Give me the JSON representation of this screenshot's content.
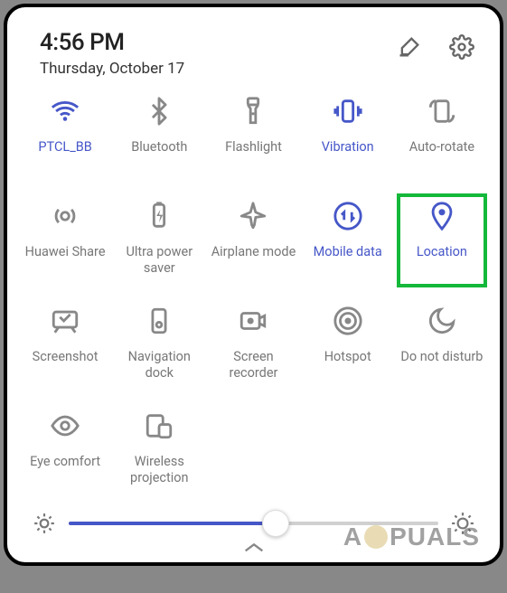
{
  "header": {
    "time": "4:56 PM",
    "date": "Thursday, October 17"
  },
  "tiles": [
    {
      "id": "wifi",
      "label": "PTCL_BB",
      "active": true,
      "highlight": false
    },
    {
      "id": "bluetooth",
      "label": "Bluetooth",
      "active": false,
      "highlight": false
    },
    {
      "id": "flashlight",
      "label": "Flashlight",
      "active": false,
      "highlight": false
    },
    {
      "id": "vibration",
      "label": "Vibration",
      "active": true,
      "highlight": false
    },
    {
      "id": "autorotate",
      "label": "Auto-rotate",
      "active": false,
      "highlight": false
    },
    {
      "id": "huaweishare",
      "label": "Huawei Share",
      "active": false,
      "highlight": false
    },
    {
      "id": "ultrapower",
      "label": "Ultra power\nsaver",
      "active": false,
      "highlight": false
    },
    {
      "id": "airplane",
      "label": "Airplane mode",
      "active": false,
      "highlight": false
    },
    {
      "id": "mobiledata",
      "label": "Mobile data",
      "active": true,
      "highlight": false
    },
    {
      "id": "location",
      "label": "Location",
      "active": true,
      "highlight": true
    },
    {
      "id": "screenshot",
      "label": "Screenshot",
      "active": false,
      "highlight": false
    },
    {
      "id": "navdock",
      "label": "Navigation\ndock",
      "active": false,
      "highlight": false
    },
    {
      "id": "screenrec",
      "label": "Screen\nrecorder",
      "active": false,
      "highlight": false
    },
    {
      "id": "hotspot",
      "label": "Hotspot",
      "active": false,
      "highlight": false
    },
    {
      "id": "dnd",
      "label": "Do not disturb",
      "active": false,
      "highlight": false
    },
    {
      "id": "eyecomfort",
      "label": "Eye comfort",
      "active": false,
      "highlight": false
    },
    {
      "id": "wirelessproj",
      "label": "Wireless\nprojection",
      "active": false,
      "highlight": false
    }
  ],
  "brightness_percent": 56,
  "watermark": "A PUALS"
}
